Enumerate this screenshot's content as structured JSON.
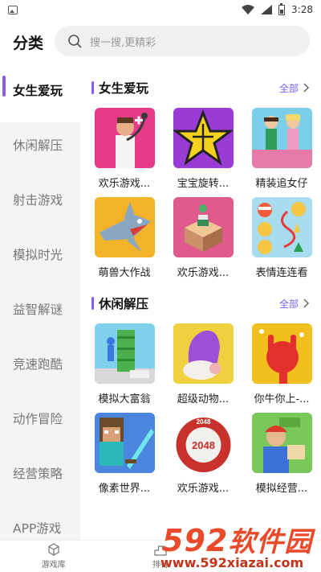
{
  "status_bar": {
    "time": "3:28",
    "icons": [
      "image-icon",
      "wifi-icon",
      "signal-icon",
      "battery-icon"
    ]
  },
  "header": {
    "title": "分类",
    "search_placeholder": "搜一搜,更精彩"
  },
  "sidebar": {
    "items": [
      {
        "label": "女生爱玩",
        "active": true
      },
      {
        "label": "休闲解压"
      },
      {
        "label": "射击游戏"
      },
      {
        "label": "模拟时光"
      },
      {
        "label": "益智解谜"
      },
      {
        "label": "竞速跑酷"
      },
      {
        "label": "动作冒险"
      },
      {
        "label": "经营策略"
      },
      {
        "label": "APP游戏"
      }
    ]
  },
  "sections": [
    {
      "title": "女生爱玩",
      "more_label": "全部",
      "games": [
        {
          "name": "欢乐游戏...",
          "thumb": "doctor-game"
        },
        {
          "name": "宝宝旋转...",
          "thumb": "star-puzzle"
        },
        {
          "name": "精装追女仔",
          "thumb": "dancing-girls"
        },
        {
          "name": "萌兽大作战",
          "thumb": "shark-monster"
        },
        {
          "name": "欢乐游戏...",
          "thumb": "box-stack"
        },
        {
          "name": "表情连连看",
          "thumb": "emoji-match"
        }
      ]
    },
    {
      "title": "休闲解压",
      "more_label": "全部",
      "games": [
        {
          "name": "模拟大富翁",
          "thumb": "money-tower"
        },
        {
          "name": "超级动物...",
          "thumb": "purple-sheep"
        },
        {
          "name": "你牛你上-...",
          "thumb": "red-hand"
        },
        {
          "name": "像素世界...",
          "thumb": "pixel-world"
        },
        {
          "name": "欢乐游戏...",
          "thumb": "2048-ball"
        },
        {
          "name": "模拟经营...",
          "thumb": "money-runner"
        }
      ]
    }
  ],
  "bottom_nav": {
    "items": [
      {
        "label": "游戏库"
      },
      {
        "label": "排行"
      },
      {
        "label": ""
      }
    ]
  },
  "watermark": {
    "logo_number": "592",
    "logo_text": "软件园",
    "url": "www.592xiazai.com"
  },
  "colors": {
    "accent": "#8a5cf6",
    "more_link": "#7b5cf0",
    "watermark": "#e84a2a"
  }
}
